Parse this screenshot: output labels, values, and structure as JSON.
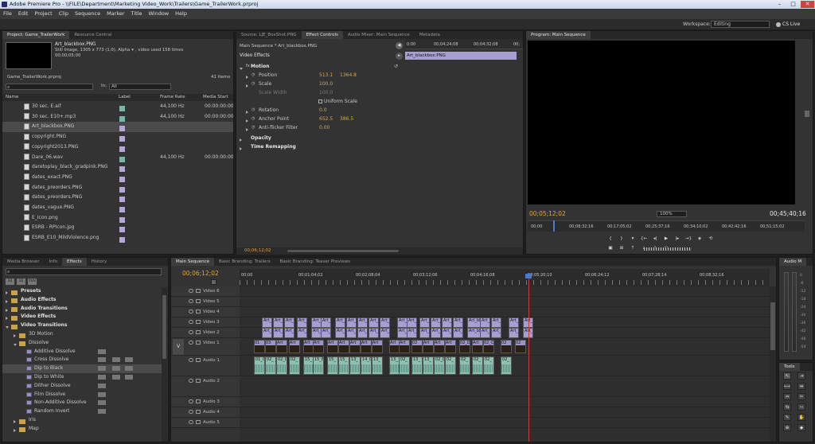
{
  "window": {
    "title": "Adobe Premiere Pro - \\\\FILE\\Department\\Marketing Video_Work\\Trailers\\Game_TrailerWork.prproj"
  },
  "menu": [
    "File",
    "Edit",
    "Project",
    "Clip",
    "Sequence",
    "Marker",
    "Title",
    "Window",
    "Help"
  ],
  "workspace": {
    "label": "Workspace:",
    "value": "Editing",
    "cslive": "CS Live"
  },
  "project": {
    "tabs": [
      "Project: Game_TrailerWork",
      "Resource Central"
    ],
    "preview_name": "Art_blackbox.PNG",
    "preview_info1": "Still Image, 1305 x 773 (1.0), Alpha",
    "preview_info2": ", video used 158 times",
    "preview_info3": "00;00;05;00",
    "bin": "Game_TrailerWork.prproj",
    "items_count": "41 Items",
    "in_label": "In:",
    "in_value": "All",
    "columns": [
      "Name",
      "Label",
      "Frame Rate",
      "Media Start"
    ],
    "rows": [
      {
        "name": "30 sec. E.aif",
        "rate": "44,100 Hz",
        "start": "00:00:00:00"
      },
      {
        "name": "30 sec. E10+.mp3",
        "rate": "44,100 Hz",
        "start": "00:00:00:00"
      },
      {
        "name": "Art_blackbox.PNG",
        "rate": "",
        "start": ""
      },
      {
        "name": "copyright.PNG",
        "rate": "",
        "start": ""
      },
      {
        "name": "copyright2013.PNG",
        "rate": "",
        "start": ""
      },
      {
        "name": "Dare_06.wav",
        "rate": "44,100 Hz",
        "start": "00:00:00:00"
      },
      {
        "name": "daretoplay_black_gradpink.PNG",
        "rate": "",
        "start": ""
      },
      {
        "name": "dates_exact.PNG",
        "rate": "",
        "start": ""
      },
      {
        "name": "dates_preorders.PNG",
        "rate": "",
        "start": ""
      },
      {
        "name": "dates_preorders.PNG",
        "rate": "",
        "start": ""
      },
      {
        "name": "dates_vague.PNG",
        "rate": "",
        "start": ""
      },
      {
        "name": "E_Icon.png",
        "rate": "",
        "start": ""
      },
      {
        "name": "ESRB - RPIcon.jpg",
        "rate": "",
        "start": ""
      },
      {
        "name": "ESRB_E10_MildViolence.png",
        "rate": "",
        "start": ""
      }
    ]
  },
  "effect_controls": {
    "tabs": [
      "Source: LJE_BoxShot.PNG",
      "Effect Controls",
      "Audio Mixer: Main Sequence",
      "Metadata"
    ],
    "sequence": "Main Sequence * Art_blackbox.PNG",
    "section": "Video Effects",
    "ruler": [
      "0;00",
      "00;04;24;08",
      "00;04;32;08",
      "00;"
    ],
    "clip_label": "Art_blackbox.PNG",
    "params": [
      {
        "label": "Motion",
        "v1": "",
        "v2": ""
      },
      {
        "label": "Position",
        "v1": "513.1",
        "v2": "1364.8"
      },
      {
        "label": "Scale",
        "v1": "100.0",
        "v2": ""
      },
      {
        "label": "Scale Width",
        "v1": "100.0",
        "v2": ""
      },
      {
        "label": "Uniform Scale",
        "v1": "",
        "v2": ""
      },
      {
        "label": "Rotation",
        "v1": "0.0",
        "v2": ""
      },
      {
        "label": "Anchor Point",
        "v1": "652.5",
        "v2": "386.5"
      },
      {
        "label": "Anti-flicker Filter",
        "v1": "0.00",
        "v2": ""
      },
      {
        "label": "Opacity",
        "v1": "",
        "v2": ""
      },
      {
        "label": "Time Remapping",
        "v1": "",
        "v2": ""
      }
    ],
    "timecode": "00;06;12;02"
  },
  "program": {
    "tab": "Program: Main Sequence",
    "timecode": "00;05;12;02",
    "zoom": "100%",
    "duration": "00;45;40;16",
    "ruler": [
      "00;00",
      "00;08;32;16",
      "00;17;05;02",
      "00;25;37;16",
      "00;34;10;02",
      "00;42;42;16",
      "00;51;15;02"
    ]
  },
  "effects": {
    "tabs": [
      "Media Browser",
      "Info",
      "Effects",
      "History"
    ],
    "tree": [
      {
        "label": "Presets",
        "level": 0,
        "type": "folder",
        "open": false
      },
      {
        "label": "Audio Effects",
        "level": 0,
        "type": "folder",
        "open": false
      },
      {
        "label": "Audio Transitions",
        "level": 0,
        "type": "folder",
        "open": false
      },
      {
        "label": "Video Effects",
        "level": 0,
        "type": "folder",
        "open": false
      },
      {
        "label": "Video Transitions",
        "level": 0,
        "type": "folder",
        "open": true
      },
      {
        "label": "3D Motion",
        "level": 1,
        "type": "folder",
        "open": false
      },
      {
        "label": "Dissolve",
        "level": 1,
        "type": "folder",
        "open": true
      },
      {
        "label": "Additive Dissolve",
        "level": 2,
        "type": "fx",
        "open": false
      },
      {
        "label": "Cross Dissolve",
        "level": 2,
        "type": "fx",
        "open": false
      },
      {
        "label": "Dip to Black",
        "level": 2,
        "type": "fx",
        "open": false
      },
      {
        "label": "Dip to White",
        "level": 2,
        "type": "fx",
        "open": false
      },
      {
        "label": "Dither Dissolve",
        "level": 2,
        "type": "fx",
        "open": false
      },
      {
        "label": "Film Dissolve",
        "level": 2,
        "type": "fx",
        "open": false
      },
      {
        "label": "Non-Additive Dissolve",
        "level": 2,
        "type": "fx",
        "open": false
      },
      {
        "label": "Random Invert",
        "level": 2,
        "type": "fx",
        "open": false
      },
      {
        "label": "Iris",
        "level": 1,
        "type": "folder",
        "open": false
      },
      {
        "label": "Map",
        "level": 1,
        "type": "folder",
        "open": false
      }
    ]
  },
  "timeline": {
    "tabs": [
      "Main Sequence",
      "Basic Branding: Trailers",
      "Basic Branding: Teaser Previews"
    ],
    "timecode": "00;06;12;02",
    "ruler": [
      "00;00",
      "00;01;04;02",
      "00;02;08;04",
      "00;03;12;06",
      "00;04;16;08",
      "00;05;20;10",
      "00;06;24;12",
      "00;07;28;14",
      "00;08;32;16"
    ],
    "tracks": [
      {
        "label": "Video 6",
        "kind": "video"
      },
      {
        "label": "Video 5",
        "kind": "video"
      },
      {
        "label": "Video 4",
        "kind": "video"
      },
      {
        "label": "Video 3",
        "kind": "video"
      },
      {
        "label": "Video 2",
        "kind": "video"
      },
      {
        "label": "Video 1",
        "kind": "video"
      },
      {
        "label": "Audio 1",
        "kind": "audio"
      },
      {
        "label": "Audio 2",
        "kind": "audio"
      },
      {
        "label": "Audio 3",
        "kind": "audio"
      },
      {
        "label": "Audio 4",
        "kind": "audio"
      },
      {
        "label": "Audio 5",
        "kind": "audio"
      }
    ],
    "v3_labels": [
      "Art_b",
      "Art_b",
      "Art_b",
      "Art_b",
      "Art_b",
      "Art_b",
      "Art_b",
      "Art_b",
      "Art_b",
      "Art_b",
      "Art_b",
      "Art_b",
      "Art_b",
      "Art_b",
      "Art_b",
      "Art_b",
      "Art_b",
      "Art_blac",
      "Art_b",
      "Art_b",
      "Art_b",
      "Art_b"
    ],
    "v1_labels": [
      "01",
      "03",
      "Art",
      "Art",
      "Art",
      "Art",
      "Art",
      "Art",
      "Art",
      "Art",
      "Art",
      "Art",
      "Art",
      "02",
      "Art",
      "Art",
      "Art",
      "02_Dag",
      "Art",
      "02_C",
      "02",
      "02"
    ],
    "a1_labels": [
      "01_0",
      "02_",
      "02_Da",
      "02_",
      "15_",
      "15_B",
      "15_",
      "15_",
      "13_",
      "14_G",
      "13_",
      "13_",
      "02_",
      "13_",
      "13_",
      "02_Dagr",
      "02_",
      "02_",
      "02_",
      "02_",
      "02_"
    ]
  },
  "audio_meter": {
    "tab": "Audio M"
  },
  "tools": {
    "tab": "Tools"
  },
  "colors": {
    "accent": "#e2a43b",
    "playhead": "#d23a3a",
    "video_clip": "#a79fd0",
    "audio_clip": "#8fbfb0"
  }
}
